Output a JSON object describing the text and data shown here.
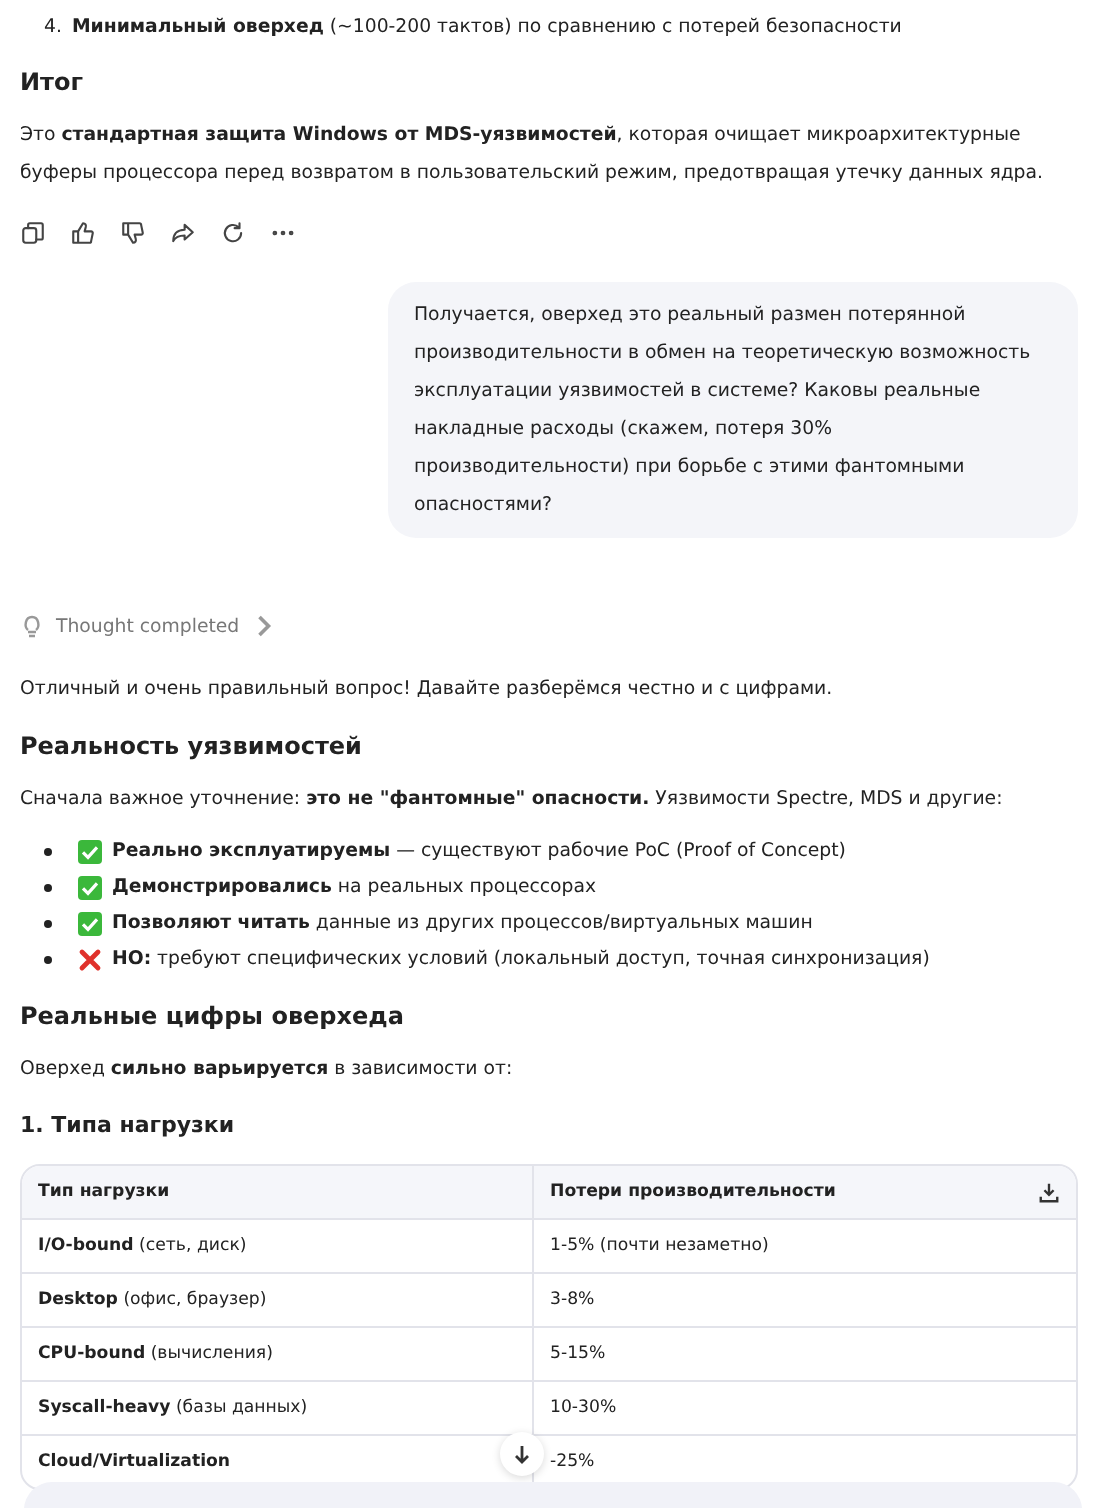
{
  "prev_item": {
    "number": "4.",
    "text": "**Минимальный оверхед** (~100-200 тактов) по сравнению с потерей безопасности"
  },
  "summary": {
    "heading": "Итог",
    "text": "Это **стандартная защита Windows от MDS-уязвимостей**, которая очищает микроархитектурные буферы процессора перед возвратом в пользовательский режим, предотвращая утечку данных ядра."
  },
  "actions": [
    {
      "kind": "copy"
    },
    {
      "kind": "like"
    },
    {
      "kind": "dislike"
    },
    {
      "kind": "share"
    },
    {
      "kind": "regenerate"
    },
    {
      "kind": "more"
    }
  ],
  "user_message": "Получается, оверхед это реальный размен потерянной производительности в обмен на теоретическую возможность эксплуатации уязвимостей в системе? Каковы реальные накладные расходы (скажем, потеря 30% производительности) при борьбе с этими фантомными опасностями?",
  "thought": {
    "label": "Thought completed",
    "expanded": false
  },
  "answer": [
    {
      "kind": "paragraph",
      "text": "Отличный и очень правильный вопрос! Давайте разберёмся честно и с цифрами."
    },
    {
      "kind": "heading",
      "text": "Реальность уязвимостей"
    },
    {
      "kind": "paragraph",
      "text": "Сначала важное уточнение: **это не \"фантомные\" опасности.** Уязвимости Spectre, MDS и другие:"
    },
    {
      "kind": "list",
      "items": [
        {
          "kind": "check",
          "text": "**Реально эксплуатируемы** — существуют рабочие PoC (Proof of Concept)"
        },
        {
          "kind": "check",
          "text": "**Демонстрировались** на реальных процессорах"
        },
        {
          "kind": "check",
          "text": "**Позволяют читать** данные из других процессов/виртуальных машин"
        },
        {
          "kind": "cross",
          "text": "**НО:** требуют специфических условий (локальный доступ, точная синхронизация)"
        }
      ]
    },
    {
      "kind": "heading",
      "text": "Реальные цифры оверхеда"
    },
    {
      "kind": "paragraph",
      "text": "Оверхед **сильно варьируется** в зависимости от:"
    },
    {
      "kind": "subheading",
      "text": "1. Типа нагрузки"
    }
  ],
  "table": {
    "columns": [
      "Тип нагрузки",
      "Потери производительности"
    ],
    "rows": [
      [
        "**I/O-bound** (сеть, диск)",
        "1-5% (почти незаметно)"
      ],
      [
        "**Desktop** (офис, браузер)",
        "3-8%"
      ],
      [
        "**CPU-bound** (вычисления)",
        "5-15%"
      ],
      [
        "**Syscall-heavy** (базы данных)",
        "10-30%"
      ],
      [
        "**Cloud/Virtualization**",
        "-25%"
      ]
    ]
  }
}
